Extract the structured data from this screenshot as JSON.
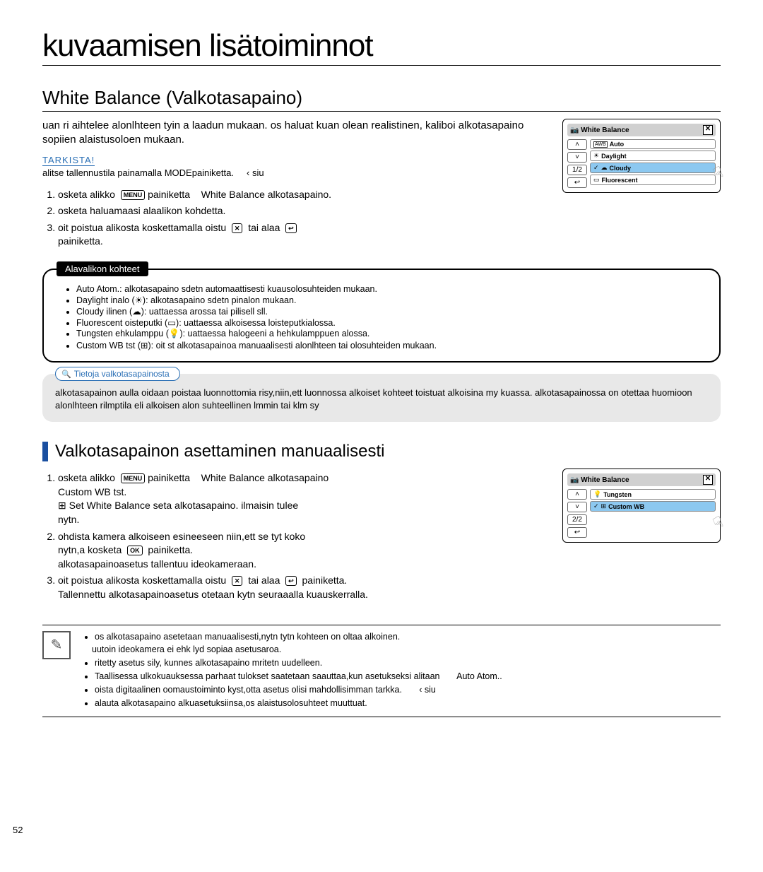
{
  "page_number": "52",
  "chapter_title": "kuvaamisen lisätoiminnot",
  "section1": {
    "title": "White Balance (Valkotasapaino)",
    "intro": "uan ri aihtelee alonlhteen tyin a laadun mukaan. os haluat kuan olean realistinen, kaliboi alkotasapaino sopiien alaistusoloen mukaan.",
    "check_label": "TARKISTA!",
    "mode_line_a": "alitse tallennustila painamalla MODEpainiketta.",
    "mode_line_b": "‹ siu",
    "steps": {
      "s1a": "osketa alikko",
      "s1b": "painiketta",
      "s1c": "White Balance alkotasapaino.",
      "s2": "osketa haluamaasi alaalikon kohdetta.",
      "s3a": "oit poistua alikosta koskettamalla oistu",
      "s3b": "tai alaa",
      "s3c": "painiketta."
    },
    "submenu_title": "Alavalikon kohteet",
    "items": {
      "auto_label": "Auto Atom.:",
      "auto_text": "alkotasapaino sdetn automaattisesti kuausolosuhteiden mukaan.",
      "day_label": "Daylight inalo (",
      "day_text": "): alkotasapaino sdetn pinalon mukaan.",
      "cloud_label": "Cloudy ilinen (",
      "cloud_text": "): uattaessa arossa tai pilisell sll.",
      "fluo_label": "Fluorescent oisteputki (",
      "fluo_text": "): uattaessa alkoisessa loisteputkialossa.",
      "tung_label": "Tungsten ehkulamppu (",
      "tung_text": "): uattaessa halogeeni a hehkulamppuen alossa.",
      "cust_label": "Custom WB  tst",
      "cust_text": "): oit st alkotasapainoa manuaalisesti alonlhteen tai olosuhteiden mukaan."
    },
    "info_tab": "Tietoja valkotasapainosta",
    "info_text": "alkotasapainon aulla oidaan poistaa luonnottomia risy,niin,ett luonnossa alkoiset kohteet toistuat alkoisina my kuassa. alkotasapainossa on otettaa huomioon alonlhteen rilmptila eli alkoisen alon suhteellinen lmmin tai klm sy"
  },
  "screen1": {
    "title": "White Balance",
    "nav_page": "1/2",
    "items": {
      "auto": "Auto",
      "daylight": "Daylight",
      "cloudy": "Cloudy",
      "fluorescent": "Fluorescent"
    }
  },
  "section2": {
    "title": "Valkotasapainon asettaminen manuaalisesti",
    "steps": {
      "s1a": "osketa alikko",
      "s1b": "painiketta",
      "s1c": "White Balance  alkotasapaino",
      "s1d": "Custom WB tst.",
      "s1e": "Set White Balance seta alkotasapaino. ilmaisin tulee",
      "s1f": "nytn.",
      "s2a": "ohdista kamera alkoiseen esineeseen niin,ett se tyt koko",
      "s2b": "nytn,a kosketa",
      "s2c": "painiketta.",
      "s2d": "alkotasapainoasetus tallentuu ideokameraan.",
      "s3a": "oit poistua alikosta koskettamalla oistu",
      "s3b": "tai alaa",
      "s3c": "painiketta.",
      "s3d": "Tallennettu alkotasapainoasetus otetaan kytn seuraaalla kuauskerralla."
    }
  },
  "screen2": {
    "title": "White Balance",
    "nav_page": "2/2",
    "items": {
      "tungsten": "Tungsten",
      "custom": "Custom WB"
    }
  },
  "notes": {
    "n1": "os alkotasapaino asetetaan manuaalisesti,nytn tytn kohteen on oltaa alkoinen.",
    "n2": "uutoin ideokamera ei ehk lyd sopiaa asetusaroa.",
    "n3": "ritetty asetus sily, kunnes alkotasapaino mritetn uudelleen.",
    "n4a": "Taallisessa ulkokuauksessa parhaat tulokset saatetaan saauttaa,kun asetukseksi alitaan",
    "n4b": "Auto Atom..",
    "n5a": "oista digitaalinen oomaustoiminto kyst,otta asetus olisi mahdollisimman tarkka.",
    "n5b": "‹ siu",
    "n6": "alauta alkotasapaino alkuasetuksiinsa,os alaistusolosuhteet muuttuat."
  },
  "icons": {
    "menu": "MENU",
    "ok": "OK",
    "close": "✕",
    "return": "↩",
    "up": "˄",
    "down": "˅",
    "awb": "AWB",
    "sun": "☀",
    "cloud": "☁",
    "fluo": "▭",
    "bulb": "💡",
    "custom": "⊞",
    "check": "✓"
  }
}
